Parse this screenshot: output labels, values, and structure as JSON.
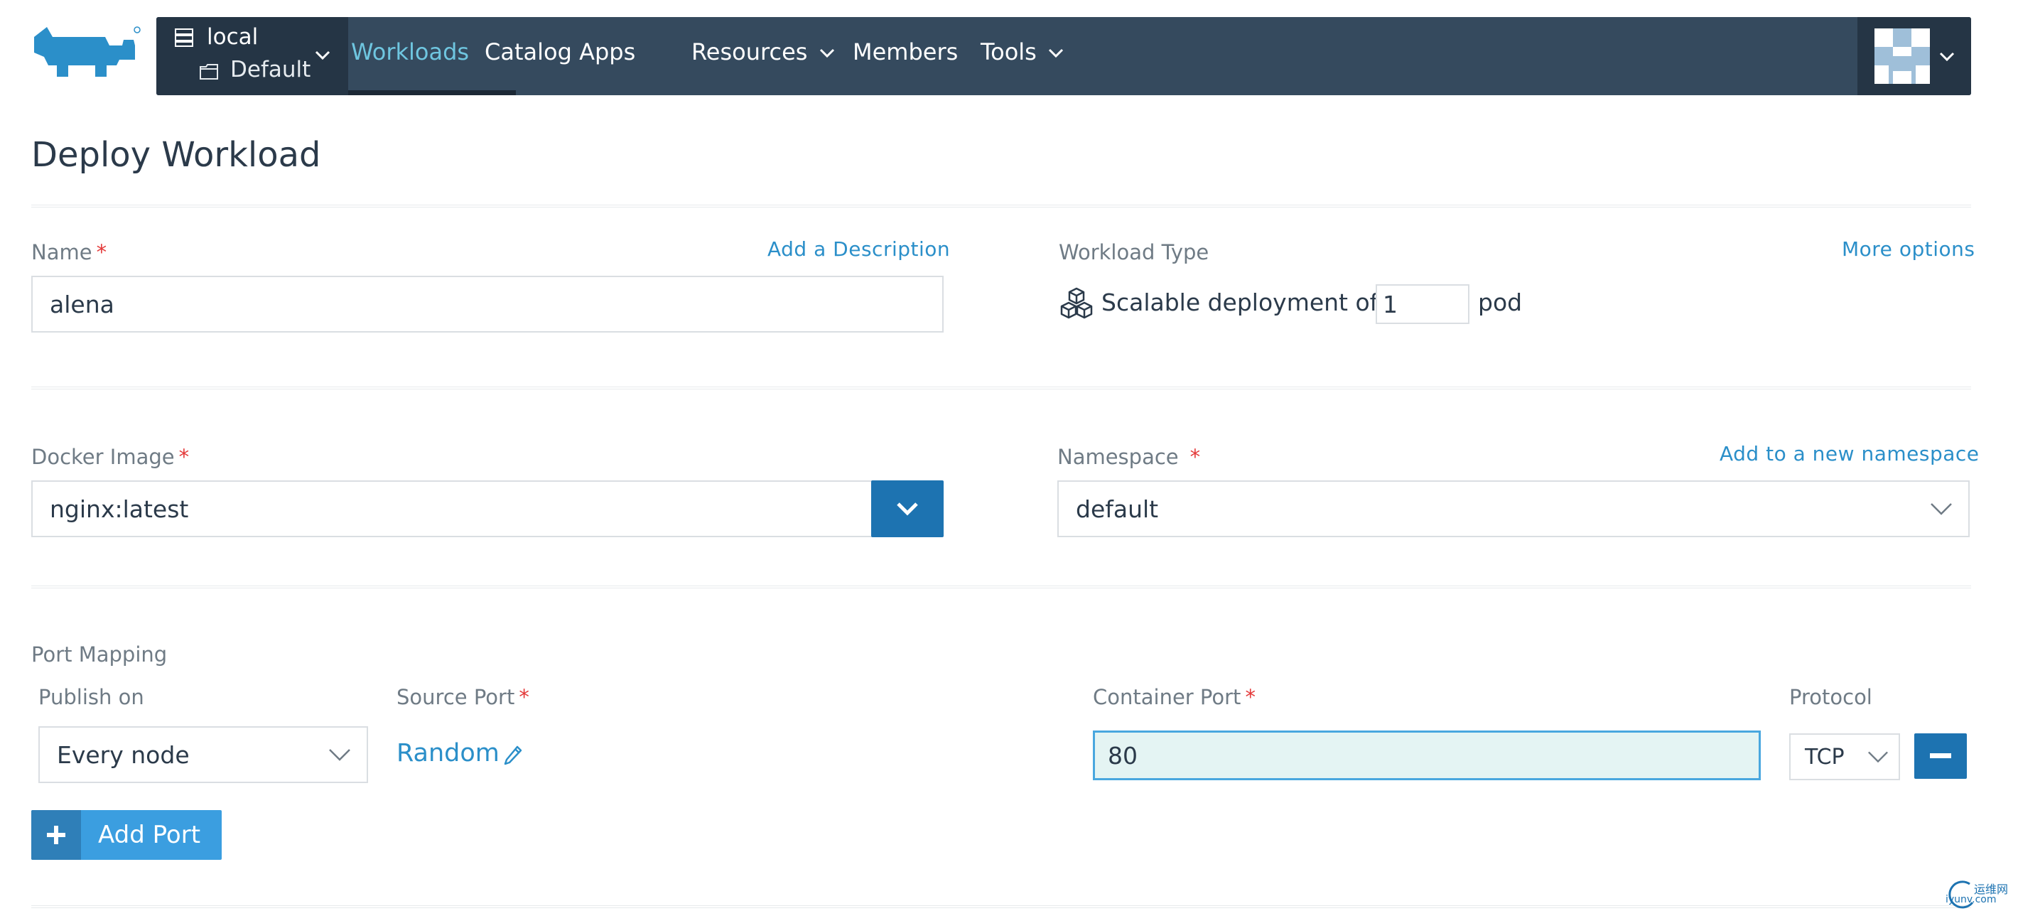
{
  "header": {
    "cluster_name": "local",
    "project_name": "Default",
    "nav": [
      {
        "label": "Workloads",
        "active": true
      },
      {
        "label": "Catalog Apps"
      },
      {
        "label": "Resources",
        "dropdown": true
      },
      {
        "label": "Members"
      },
      {
        "label": "Tools",
        "dropdown": true
      }
    ],
    "logo_icon": "rancher-logo",
    "colors": {
      "navbar": "#354a5e",
      "active_link": "#6fc6e0",
      "accent": "#1d73b1"
    }
  },
  "page": {
    "title": "Deploy Workload"
  },
  "name_field": {
    "label": "Name",
    "required_mark": "*",
    "value": "alena",
    "add_description_link": "Add a Description"
  },
  "workload_type": {
    "label": "Workload Type",
    "more_options_link": "More options",
    "prefix": "Scalable deployment of",
    "pods_value": "1",
    "suffix": "pod"
  },
  "docker_image": {
    "label": "Docker Image",
    "required_mark": "*",
    "value": "nginx:latest"
  },
  "namespace": {
    "label": "Namespace",
    "required_mark": "*",
    "add_link": "Add to a new namespace",
    "value": "default"
  },
  "port_mapping": {
    "section_label": "Port Mapping",
    "publish_on_label": "Publish on",
    "publish_on_value": "Every node",
    "source_port_label": "Source Port",
    "source_port_required": "*",
    "source_port_value": "Random",
    "container_port_label": "Container Port",
    "container_port_required": "*",
    "container_port_value": "80",
    "protocol_label": "Protocol",
    "protocol_value": "TCP",
    "add_port_button": "Add Port"
  },
  "watermark": {
    "line1": "运维网",
    "line2": "iyunv.com"
  }
}
